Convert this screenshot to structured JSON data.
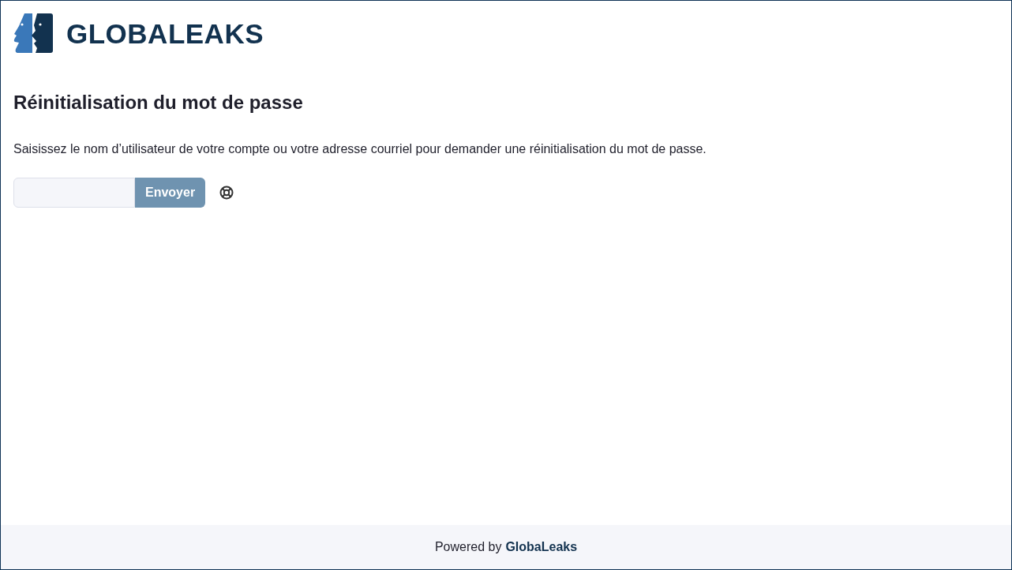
{
  "header": {
    "logo_text": "GLOBALEAKS"
  },
  "page": {
    "title": "Réinitialisation du mot de passe",
    "instructions": "Saisissez le nom d’utilisateur de votre compte ou votre adresse courriel pour demander une réinitialisation du mot de passe.",
    "submit_button": {
      "label": "Envoyer",
      "disabled": true
    }
  },
  "footer": {
    "text": "Powered by",
    "link": "GlobaLeaks"
  }
}
